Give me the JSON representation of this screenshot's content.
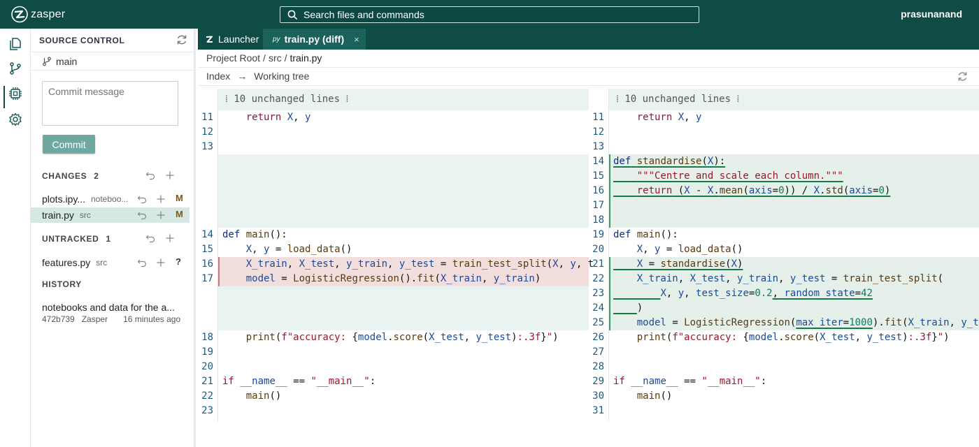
{
  "app": {
    "name": "zasper",
    "user": "prasunanand"
  },
  "search": {
    "placeholder": "Search files and commands"
  },
  "colors": {
    "brand": "#0f4c45",
    "added_bg": "#e5f0ea",
    "removed_bg": "#f3dede",
    "collapsed_bg": "#e9f3f1"
  },
  "activity": {
    "icons": [
      "files-icon",
      "source-control-icon",
      "chip-icon",
      "gear-icon"
    ]
  },
  "source_control": {
    "title": "SOURCE CONTROL",
    "branch": "main",
    "commit_placeholder": "Commit message",
    "commit_label": "Commit",
    "changes": {
      "label": "CHANGES",
      "count": "2",
      "files": [
        {
          "name": "plots.ipy...",
          "dir": "noteboo...",
          "status": "M"
        },
        {
          "name": "train.py",
          "dir": "src",
          "status": "M"
        }
      ]
    },
    "untracked": {
      "label": "UNTRACKED",
      "count": "1",
      "files": [
        {
          "name": "features.py",
          "dir": "src",
          "status": "?"
        }
      ]
    },
    "history": {
      "label": "HISTORY",
      "message": "notebooks and data for the a...",
      "hash": "472b739",
      "author": "Zasper",
      "time": "16 minutes ago"
    }
  },
  "tabs": [
    {
      "label": "Launcher"
    },
    {
      "prefix": "py",
      "label": "train.py (diff)",
      "close": "×"
    }
  ],
  "breadcrumb": {
    "root": "Project Root",
    "sep": "/",
    "dir": "src",
    "file": "train.py"
  },
  "compare": {
    "from": "Index",
    "arrow": "→",
    "to": "Working tree"
  },
  "diff": {
    "collapsed_label": "⁞ 10 unchanged lines ⁞",
    "left_line_numbers": [
      "11",
      "12",
      "13",
      "14",
      "15",
      "16",
      "17",
      "18",
      "19",
      "20",
      "21",
      "22",
      "23"
    ],
    "right_line_numbers": [
      "11",
      "12",
      "13",
      "14",
      "15",
      "16",
      "17",
      "18",
      "19",
      "20",
      "21",
      "22",
      "23",
      "24",
      "25",
      "26",
      "27",
      "28",
      "29",
      "30",
      "31"
    ]
  }
}
